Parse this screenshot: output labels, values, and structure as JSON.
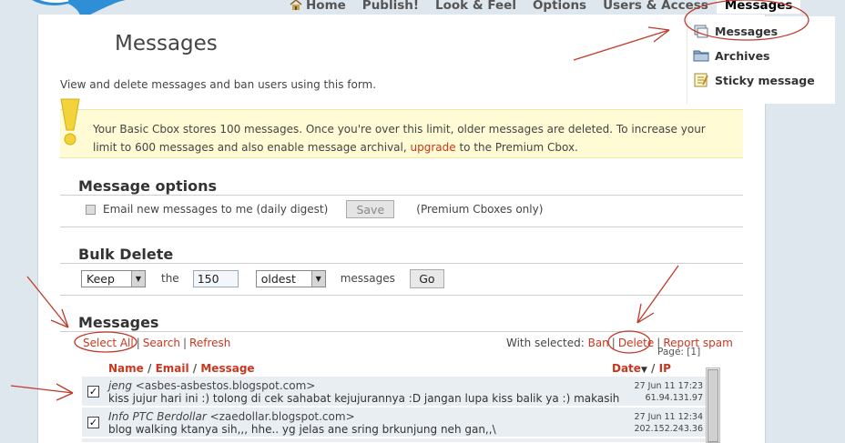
{
  "nav": {
    "items": [
      {
        "label": "Home",
        "icon": "home-icon"
      },
      {
        "label": "Publish!"
      },
      {
        "label": "Look & Feel"
      },
      {
        "label": "Options"
      },
      {
        "label": "Users & Access"
      },
      {
        "label": "Messages",
        "active": true
      }
    ]
  },
  "dropdown": {
    "items": [
      {
        "label": "Messages",
        "icon": "messages-icon"
      },
      {
        "label": "Archives",
        "icon": "folder-icon"
      },
      {
        "label": "Sticky message",
        "icon": "note-icon"
      }
    ]
  },
  "page": {
    "title": "Messages",
    "description": "View and delete messages and ban users using this form."
  },
  "notice": {
    "text_before": "Your Basic Cbox stores 100 messages. Once you're over this limit, older messages are deleted. To increase your limit to 600 messages and also enable message archival, ",
    "link": "upgrade",
    "text_after": " to the Premium Cbox."
  },
  "message_options": {
    "heading": "Message options",
    "email_label": "Email new messages to me (daily digest)",
    "save_label": "Save",
    "premium_note": "(Premium Cboxes only)"
  },
  "bulk_delete": {
    "heading": "Bulk Delete",
    "action_value": "Keep",
    "the_label": "the",
    "count_value": "150",
    "order_value": "oldest",
    "messages_label": "messages",
    "go_label": "Go"
  },
  "messages": {
    "heading": "Messages",
    "select_all": "Select All",
    "search": "Search",
    "refresh": "Refresh",
    "with_selected": "With selected:",
    "ban": "Ban",
    "delete": "Delete",
    "report_spam": "Report spam",
    "page_indicator": "Page: [1]",
    "columns": {
      "name": "Name",
      "email": "Email",
      "message": "Message",
      "date": "Date",
      "ip": "IP"
    },
    "rows": [
      {
        "name": "jeng",
        "email": "<asbes-asbestos.blogspot.com>",
        "message": "kiss jujur hari ini :) tolong di cek sahabat kejujurannya :D jangan lupa kiss balik ya :) makasih",
        "date": "27 Jun 11 17:23",
        "ip": "61.94.131.97",
        "checked": true
      },
      {
        "name": "Info PTC Berdollar",
        "email": "<zaedollar.blogspot.com>",
        "message": "blog walking ktanya sih,,, hhe.. yg jelas ane sring brkunjung neh gan,,\\",
        "date": "27 Jun 11 12:34",
        "ip": "202.152.243.36",
        "checked": true
      }
    ]
  },
  "colors": {
    "accent_link": "#c8371e",
    "notice_bg": "#fffbd4",
    "annotation_red": "#c0392b",
    "row_bg": "#e9eef3"
  }
}
